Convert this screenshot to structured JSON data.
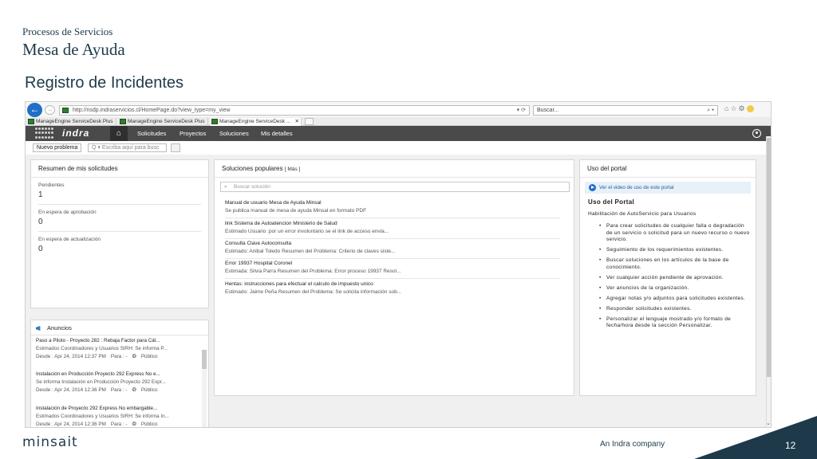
{
  "slide": {
    "kicker": "Procesos de Servicios",
    "subtitle": "Mesa de Ayuda",
    "title": "Registro de Incidentes",
    "footer_logo": "minsait",
    "footer_company": "An Indra company",
    "page_number": "12"
  },
  "browser": {
    "url": "http://nsdp.indraservicios.cl/HomePage.do?view_type=my_view",
    "url_actions": "▾ ⟳",
    "search_placeholder": "Buscar...",
    "search_action": "⌕ ▾",
    "tabs": [
      {
        "label": "ManageEngine ServiceDesk Plus"
      },
      {
        "label": "ManageEngine ServiceDesk Plus"
      },
      {
        "label": "ManageEngine ServiceDesk ..."
      }
    ],
    "tab_close": "✕"
  },
  "app": {
    "logo_text": "indra",
    "nav": [
      "Solicitudes",
      "Proyectos",
      "Soluciones",
      "Mis detalles"
    ],
    "new_request": "Nuevo problema",
    "search_placeholder": "Q ▾  Escriba aquí para busc"
  },
  "summary": {
    "title": "Resumen de mis solicitudes",
    "items": [
      {
        "label": "Pendientes",
        "value": "1"
      },
      {
        "label": "En espera de aprobación",
        "value": "0"
      },
      {
        "label": "En espera de actualización",
        "value": "0"
      }
    ]
  },
  "announcements": {
    "title": "Anuncios",
    "items": [
      {
        "title": "Paso a Piloto - Proyecto 282 : Rebaja Factor para Cál...",
        "desc": "Estimados Coordinadores y Usuarios SIRH: Se informa P...",
        "date": "Desde : Apr 24, 2014 12:37 PM",
        "to": "Para : -",
        "visibility": "Público"
      },
      {
        "title": "Instalación en Producción Proyecto 292 Express No e...",
        "desc": "Se informa Instalación en Producción Proyecto 292 Expr...",
        "date": "Desde : Apr 24, 2014 12:36 PM",
        "to": "Para : -",
        "visibility": "Público"
      },
      {
        "title": "Instalación de Proyecto 292 Express No embargable...",
        "desc": "Estimados Coordinadores y Usuarios SIRH: Se informa In...",
        "date": "Desde : Apr 24, 2014 12:36 PM",
        "to": "Para : -",
        "visibility": "Público"
      }
    ]
  },
  "solutions": {
    "title": "Soluciones populares",
    "more": "[ Más ]",
    "search_placeholder": "Buscar solución",
    "items": [
      {
        "title": "Manual de usuario Mesa de Ayuda Minsal",
        "desc": "    Se publica manual de mesa de ayuda Minsal  en formato PDF"
      },
      {
        "title": "link Sistema de Autoatencion Ministerio de Salud",
        "desc": "Estimado Usuario :por un error involuntario se el link de acceso envia..."
      },
      {
        "title": "Consulta Clave Autoconsulta",
        "desc": "Estimado: Anibal Toledo Resumen del Problema: Criterio de claves siste..."
      },
      {
        "title": "Error 19937 Hospital Coronel",
        "desc": "Estimada: Silvia Parra Resumen del Problema: Error proceso 19937 Resol..."
      },
      {
        "title": "Hentas: instrucciones para efectuar el calculo de impuesto unico",
        "desc": "Estimado: Jaime Peña Resumen del Problema: Se solicita información sob..."
      }
    ]
  },
  "portal": {
    "title": "Uso del portal",
    "video_link": "Ver el video de uso de este portal",
    "heading": "Uso del Portal",
    "intro": "Habilitación de AutoServicio para Usuarios",
    "items": [
      "Para crear solicitudes de cualquier falla o degradación de un servicio o solicitud para un nuevo recurso o nuevo servicio.",
      "Seguimiento de los requerimientos existentes.",
      "Buscar soluciones en los artículos de la base de conocimiento.",
      "Ver cualquier acción pendiente de aprovación.",
      "Ver anuncios de la organización.",
      "Agregar notas y/o adjuntos para solicitudes existentes.",
      "Responder solicitudes existentes.",
      "Personalizar el lenguaje mostrado y/o formato de fecha/hora desde la sección Personalizar."
    ]
  }
}
